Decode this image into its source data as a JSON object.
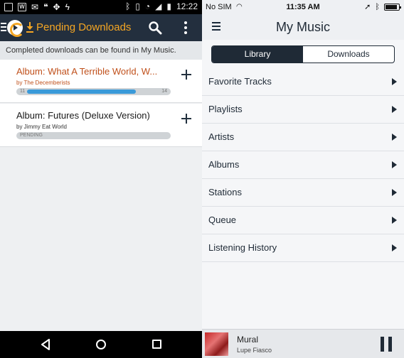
{
  "android": {
    "status_bar": {
      "time": "12:22",
      "left_icons": [
        "image-icon",
        "w-icon",
        "mail-icon",
        "hangouts-icon",
        "dropbox-icon",
        "flash-icon"
      ],
      "right_icons": [
        "bluetooth-icon",
        "vibrate-icon",
        "wifi-icon",
        "signal-icon",
        "battery-icon"
      ]
    },
    "app_bar": {
      "title": "Pending Downloads",
      "accent": "#f5a623",
      "bar_color": "#232f3e"
    },
    "info_text": "Completed downloads can be found in My Music.",
    "downloads": [
      {
        "album": "Album: What A Terrible World, W...",
        "artist": "by The Decemberists",
        "title_color": "#c0501b",
        "progress_start": "11",
        "progress_end": "14",
        "progress_fraction": 0.82,
        "status": ""
      },
      {
        "album": "Album: Futures (Deluxe Version)",
        "artist": "by Jimmy Eat World",
        "title_color": "#1a1a1a",
        "status": "PENDING"
      }
    ],
    "nav_icons": [
      "back-icon",
      "home-icon",
      "recents-icon"
    ]
  },
  "ios": {
    "status_bar": {
      "carrier": "No SIM",
      "time": "11:35 AM"
    },
    "header": {
      "title": "My Music"
    },
    "segments": [
      {
        "label": "Library",
        "selected": true
      },
      {
        "label": "Downloads",
        "selected": false
      }
    ],
    "menu": [
      {
        "label": "Favorite Tracks"
      },
      {
        "label": "Playlists"
      },
      {
        "label": "Artists"
      },
      {
        "label": "Albums"
      },
      {
        "label": "Stations"
      },
      {
        "label": "Queue"
      },
      {
        "label": "Listening History"
      }
    ],
    "now_playing": {
      "track": "Mural",
      "artist": "Lupe Fiasco"
    }
  }
}
